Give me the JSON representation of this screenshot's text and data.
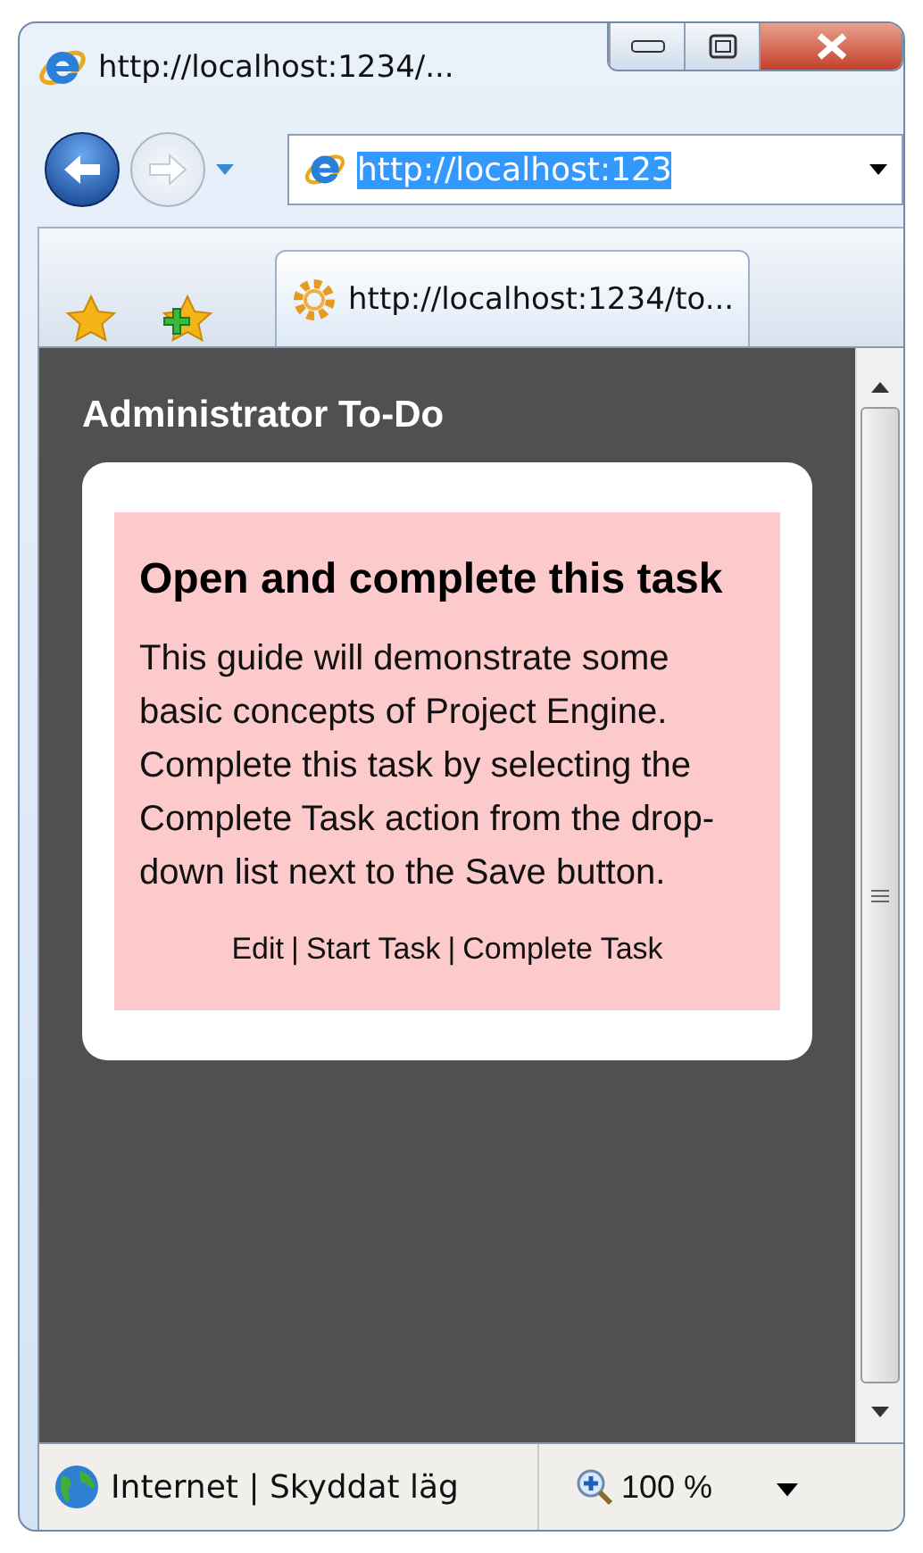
{
  "window": {
    "title": "http://localhost:1234/..."
  },
  "address_bar": {
    "value": "http://localhost:123",
    "selected": true
  },
  "tab": {
    "title": "http://localhost:1234/to...",
    "selected": true
  },
  "page": {
    "heading": "Administrator To-Do",
    "task": {
      "title": "Open and complete this task",
      "description": "This guide will demonstrate some basic concepts of Project Engine. Complete this task by selecting the Complete Task action from the drop-down list next to the Save button.",
      "actions": [
        "Edit",
        "Start Task",
        "Complete Task"
      ],
      "separator": "|"
    }
  },
  "status_bar": {
    "zone": "Internet | Skyddat läg",
    "zoom": "100 %"
  }
}
